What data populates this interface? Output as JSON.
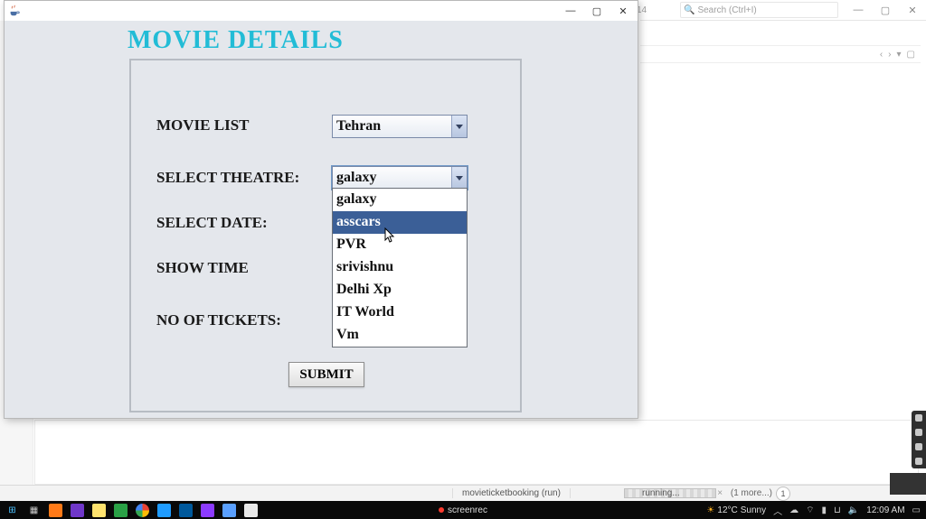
{
  "ide": {
    "tab_fragment": "14",
    "search_placeholder": "Search (Ctrl+I)",
    "subtool_glyphs": [
      "‹",
      "›",
      "▾",
      "▢"
    ],
    "status_project": "movieticketbooking (run)",
    "status_running": "running...",
    "status_more": "(1 more...)",
    "status_more_x": "×",
    "notify_count": "1"
  },
  "java_window": {
    "title": "",
    "titlebar_buttons": {
      "min": "—",
      "max": "▢",
      "close": "✕"
    },
    "heading": "MOVIE DETAILS",
    "labels": {
      "movie": "MOVIE LIST",
      "theatre": "SELECT  THEATRE:",
      "date": "SELECT DATE:",
      "show": "SHOW TIME",
      "tickets": "NO OF TICKETS:"
    },
    "movie_selected": "Tehran",
    "theatre_selected": "galaxy",
    "theatre_options": [
      "galaxy",
      "asscars",
      "PVR",
      "srivishnu",
      "Delhi Xp",
      "IT World",
      "Vm"
    ],
    "theatre_highlight_index": 1,
    "submit": "SUBMIT"
  },
  "screenrec": {
    "label": "screenrec"
  },
  "systray": {
    "weather_temp": "12°C",
    "weather_text": "Sunny",
    "time": "12:09 AM"
  },
  "colors": {
    "accent": "#22bcd6",
    "swing_dropdown_sel": "#3b5f97"
  }
}
